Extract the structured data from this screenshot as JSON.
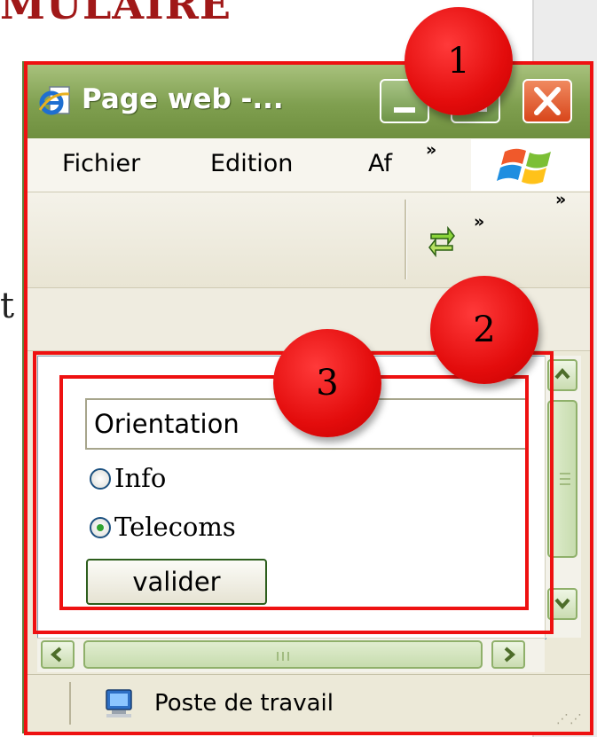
{
  "slide": {
    "title_fragment": "MULAIRE",
    "body_fragment": "t"
  },
  "window": {
    "title": "Page web -...",
    "menu": [
      "Fichier",
      "Edition",
      "Af"
    ],
    "chevron": "»",
    "status_text": "Poste de travail"
  },
  "form": {
    "select_value": "Orientation",
    "radio_options": [
      {
        "label": "Info",
        "checked": false
      },
      {
        "label": "Telecoms",
        "checked": true
      }
    ],
    "submit_label": "valider"
  },
  "callouts": [
    "1",
    "2",
    "3"
  ],
  "icons": {
    "app": "ie-page-icon",
    "refresh": "refresh-arrows-icon",
    "windows_logo": "windows-flag-logo",
    "status": "computer-icon"
  },
  "colors": {
    "title_red": "#a01818",
    "callout_red": "#e30c0c",
    "frame_red": "#ee1111",
    "xp_green": "#7f9f4f"
  }
}
